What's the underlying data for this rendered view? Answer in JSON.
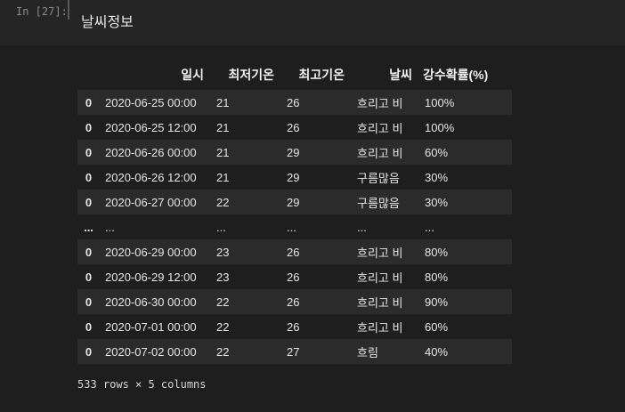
{
  "input": {
    "prompt": "In [27]:",
    "code": "날씨정보"
  },
  "table": {
    "columns": [
      "",
      "일시",
      "최저기온",
      "최고기온",
      "날씨",
      "강수확률(%)"
    ],
    "rows": [
      {
        "index": "0",
        "date": "2020-06-25 00:00",
        "min": "21",
        "max": "26",
        "weather": "흐리고 비",
        "precip": "100%"
      },
      {
        "index": "0",
        "date": "2020-06-25 12:00",
        "min": "21",
        "max": "26",
        "weather": "흐리고 비",
        "precip": "100%"
      },
      {
        "index": "0",
        "date": "2020-06-26 00:00",
        "min": "21",
        "max": "29",
        "weather": "흐리고 비",
        "precip": "60%"
      },
      {
        "index": "0",
        "date": "2020-06-26 12:00",
        "min": "21",
        "max": "29",
        "weather": "구름많음",
        "precip": "30%"
      },
      {
        "index": "0",
        "date": "2020-06-27 00:00",
        "min": "22",
        "max": "29",
        "weather": "구름많음",
        "precip": "30%"
      },
      {
        "index": "...",
        "date": "...",
        "min": "...",
        "max": "...",
        "weather": "...",
        "precip": "..."
      },
      {
        "index": "0",
        "date": "2020-06-29 00:00",
        "min": "23",
        "max": "26",
        "weather": "흐리고 비",
        "precip": "80%"
      },
      {
        "index": "0",
        "date": "2020-06-29 12:00",
        "min": "23",
        "max": "26",
        "weather": "흐리고 비",
        "precip": "80%"
      },
      {
        "index": "0",
        "date": "2020-06-30 00:00",
        "min": "22",
        "max": "26",
        "weather": "흐리고 비",
        "precip": "90%"
      },
      {
        "index": "0",
        "date": "2020-07-01 00:00",
        "min": "22",
        "max": "26",
        "weather": "흐리고 비",
        "precip": "60%"
      },
      {
        "index": "0",
        "date": "2020-07-02 00:00",
        "min": "22",
        "max": "27",
        "weather": "흐림",
        "precip": "40%"
      }
    ]
  },
  "shape_text": "533 rows × 5 columns",
  "colors": {
    "background": "#1e1e1e",
    "input_cell": "#252526",
    "row_stripe": "#2b2b2b",
    "text": "#e6e6e6"
  }
}
